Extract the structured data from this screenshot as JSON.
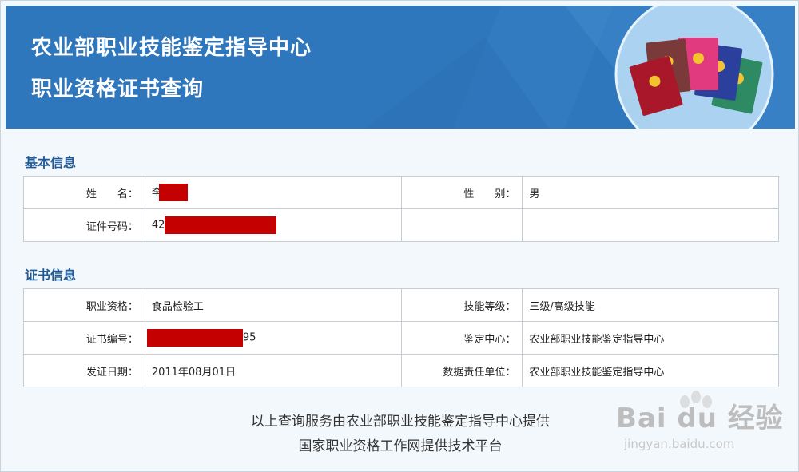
{
  "header": {
    "title_line1": "农业部职业技能鉴定指导中心",
    "title_line2": "职业资格证书查询"
  },
  "basic_info": {
    "section_title": "基本信息",
    "name_label": "姓　　名：",
    "name_value": "李",
    "gender_label": "性　　别：",
    "gender_value": "男",
    "id_label": "证件号码：",
    "id_value": "42"
  },
  "cert_info": {
    "section_title": "证书信息",
    "qualification_label": "职业资格：",
    "qualification_value": "食品检验工",
    "skill_level_label": "技能等级：",
    "skill_level_value": "三级/高级技能",
    "cert_no_label": "证书编号：",
    "cert_no_value": "95",
    "center_label": "鉴定中心：",
    "center_value": "农业部职业技能鉴定指导中心",
    "issue_date_label": "发证日期：",
    "issue_date_value": "2011年08月01日",
    "responsible_label": "数据责任单位：",
    "responsible_value": "农业部职业技能鉴定指导中心"
  },
  "footer": {
    "line1": "以上查询服务由农业部职业技能鉴定指导中心提供",
    "line2": "国家职业资格工作网提供技术平台"
  },
  "watermark": {
    "brand": "Bai du 经验",
    "url": "jingyan.baidu.com"
  },
  "colors": {
    "header_blue": "#2e77bd",
    "section_title": "#1f5a96",
    "redaction": "#c40000"
  }
}
